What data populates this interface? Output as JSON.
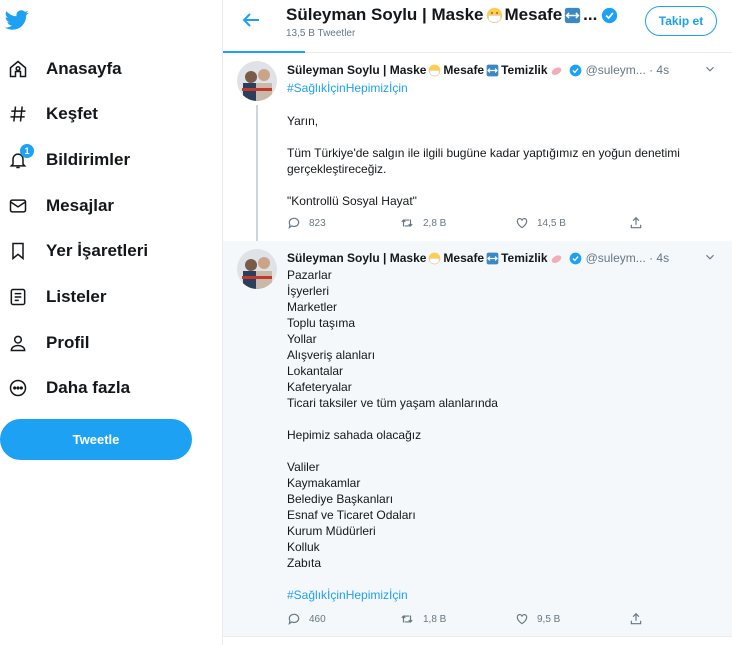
{
  "nav": {
    "items": [
      {
        "label": "Anasayfa",
        "icon": "home-icon"
      },
      {
        "label": "Keşfet",
        "icon": "hashtag-icon"
      },
      {
        "label": "Bildirimler",
        "icon": "bell-icon"
      },
      {
        "label": "Mesajlar",
        "icon": "mail-icon"
      },
      {
        "label": "Yer İşaretleri",
        "icon": "bookmark-icon"
      },
      {
        "label": "Listeler",
        "icon": "list-icon"
      },
      {
        "label": "Profil",
        "icon": "person-icon"
      },
      {
        "label": "Daha fazla",
        "icon": "more-icon"
      }
    ],
    "notifications_badge": "1",
    "tweet_button": "Tweetle"
  },
  "header": {
    "name_part1": "Süleyman Soylu | Maske",
    "name_part2": "Mesafe",
    "name_ellipsis": "...",
    "tweet_count": "13,5 B Tweetler",
    "follow_button": "Takip et"
  },
  "tweets": [
    {
      "name_part1": "Süleyman Soylu | Maske",
      "name_part2": "Mesafe",
      "name_part3": "Temizlik",
      "handle": "@suleym... · 4s",
      "hashtag": "#SağlıkİçinHepimizİçin",
      "text": "Yarın,\n\nTüm Türkiye'de salgın ile ilgili bugüne kadar yaptığımız en yoğun denetimi gerçekleştireceğiz.\n\n\"Kontrollü Sosyal Hayat\"",
      "replies": "823",
      "retweets": "2,8 B",
      "likes": "14,5 B"
    },
    {
      "name_part1": "Süleyman Soylu | Maske",
      "name_part2": "Mesafe",
      "name_part3": "Temizlik",
      "handle": "@suleym... · 4s",
      "text": "Pazarlar\nİşyerleri\nMarketler\nToplu taşıma\nYollar\nAlışveriş alanları\nLokantalar\nKafeteryalar\nTicari taksiler ve tüm yaşam alanlarında\n\nHepimiz sahada olacağız\n\nValiler\nKaymakamlar\nBelediye Başkanları\nEsnaf ve Ticaret Odaları\nKurum Müdürleri\nKolluk\nZabıta",
      "hashtag": "#SağlıkİçinHepimizİçin",
      "replies": "460",
      "retweets": "1,8 B",
      "likes": "9,5 B"
    }
  ],
  "colors": {
    "accent": "#1da1f2",
    "text": "#14171a",
    "muted": "#657786",
    "border": "#e6ecf0"
  }
}
